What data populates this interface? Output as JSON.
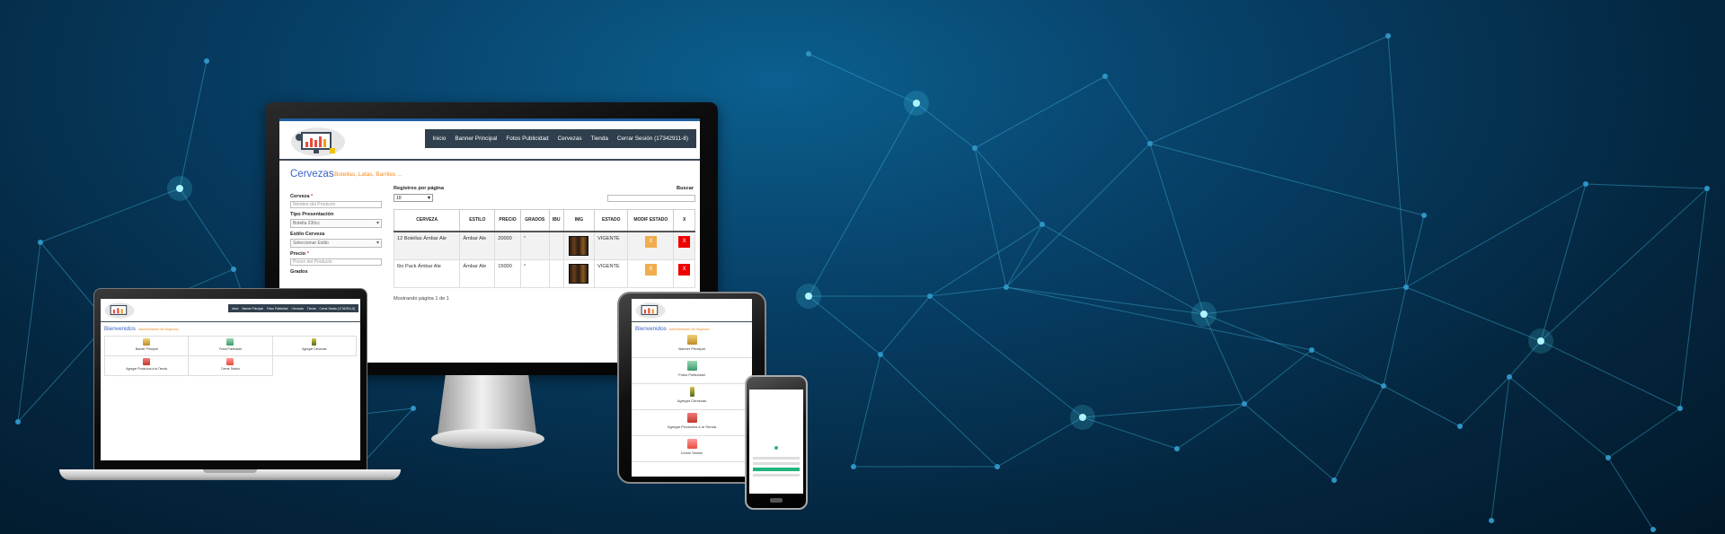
{
  "nav": {
    "items": [
      "Inicio",
      "Banner Principal",
      "Fotos Publicidad",
      "Cervezas",
      "Tienda",
      "Cerrar Sesión (17342911-8)"
    ]
  },
  "page": {
    "title": "Cervezas",
    "subtitle": "Botellas, Latas, Barriles ..."
  },
  "form": {
    "cerveza_label": "Cerveza",
    "cerveza_placeholder": "Nombre del Producto",
    "tipo_label": "Tipo Presentación",
    "tipo_value": "Botella 330cc",
    "estilo_label": "Estilo Cerveza",
    "estilo_value": "Seleccionar Estilo",
    "precio_label": "Precio",
    "precio_placeholder": "Precio del Producto",
    "grados_label": "Grados",
    "required_mark": "*"
  },
  "table": {
    "rpp_label": "Registros por página",
    "rpp_value": "10",
    "search_label": "Buscar",
    "columns": [
      "CERVEZA",
      "ESTILO",
      "PRECIO",
      "GRADOS",
      "IBU",
      "IMG",
      "ESTADO",
      "MODIF ESTADO",
      "X"
    ],
    "rows": [
      {
        "cerveza": "12 Botellas Ámbar Ale",
        "estilo": "Ámbar Ale",
        "precio": "20000",
        "grados": "°",
        "ibu": "",
        "estado": "VIGENTE",
        "modif": "X",
        "x": "X"
      },
      {
        "cerveza": "6io Pack Ámbar Ale",
        "estilo": "Ámbar Ale",
        "precio": "15000",
        "grados": "°",
        "ibu": "",
        "estado": "VIGENTE",
        "modif": "X",
        "x": "X"
      }
    ],
    "showing": "Mostrando página 1 de 1"
  },
  "dashboard": {
    "title": "Bienvenidos",
    "subtitle": "Administración de Negocios",
    "tiles": [
      "Banner Principal",
      "Fotos Publicidad",
      "Agregar Cervezas",
      "Agregar Productos a la Tienda",
      "Cerrar Sesión"
    ]
  },
  "colors": {
    "nav_bg": "#2f3f4d",
    "title_blue": "#3a63c4",
    "subtitle_orange": "#f08a24",
    "btn_modif": "#f0ad4e",
    "btn_delete": "#e00000"
  }
}
